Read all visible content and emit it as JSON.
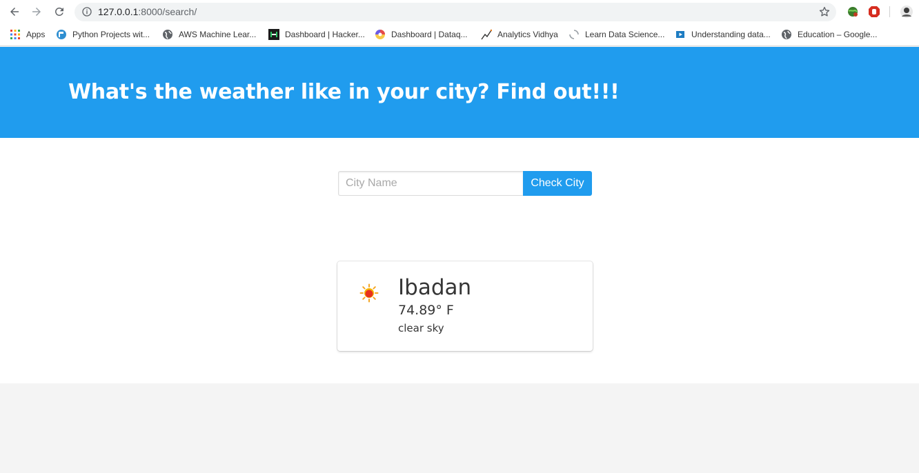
{
  "browser": {
    "url_host": "127.0.0.1",
    "url_rest": ":8000/search/",
    "bookmarks": [
      {
        "label": "Apps",
        "icon": "apps-grid-icon"
      },
      {
        "label": "Python Projects wit...",
        "icon": "python-projects-icon"
      },
      {
        "label": "AWS Machine Lear...",
        "icon": "globe-icon"
      },
      {
        "label": "Dashboard | Hacker...",
        "icon": "hackerrank-icon"
      },
      {
        "label": "Dashboard | Dataq...",
        "icon": "dataquest-icon"
      },
      {
        "label": "Analytics Vidhya",
        "icon": "analytics-vidhya-icon"
      },
      {
        "label": "Learn Data Science...",
        "icon": "loading-spinner-icon"
      },
      {
        "label": "Understanding data...",
        "icon": "video-play-icon"
      },
      {
        "label": "Education – Google...",
        "icon": "globe-icon"
      }
    ]
  },
  "hero": {
    "title": "What's the weather like in your city? Find out!!!"
  },
  "search": {
    "placeholder": "City Name",
    "value": "",
    "button_label": "Check City"
  },
  "weather_card": {
    "city": "Ibadan",
    "temperature": "74.89° F",
    "description": "clear sky",
    "icon": "sun-icon"
  },
  "colors": {
    "primary": "#209cee",
    "text": "#363636",
    "background": "#f4f4f4"
  }
}
